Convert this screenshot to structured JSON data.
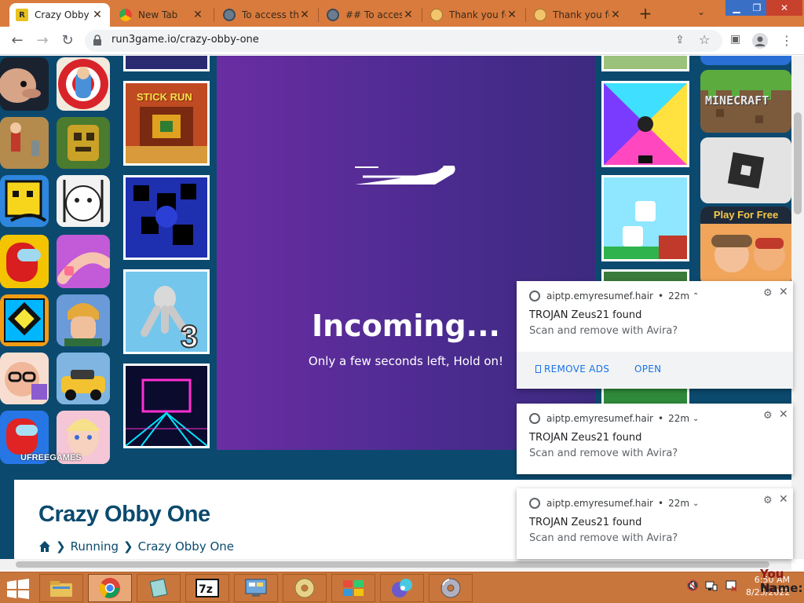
{
  "browser": {
    "tabs": [
      {
        "title": "Crazy Obby",
        "active": true,
        "favicon": "run3-icon"
      },
      {
        "title": "New Tab",
        "active": false,
        "favicon": "chrome-icon"
      },
      {
        "title": "To access th",
        "active": false,
        "favicon": "globe-icon"
      },
      {
        "title": "## To access",
        "active": false,
        "favicon": "globe-icon"
      },
      {
        "title": "Thank you fo",
        "active": false,
        "favicon": "smiley-icon"
      },
      {
        "title": "Thank you fo",
        "active": false,
        "favicon": "smiley-icon"
      }
    ],
    "url": "run3game.io/crazy-obby-one"
  },
  "page": {
    "title": "Crazy Obby One",
    "breadcrumb": [
      "Running",
      "Crazy Obby One"
    ],
    "game": {
      "loading_text": "Incoming...",
      "subtext": "Only a few seconds left, Hold on!"
    },
    "thumbs": {
      "left_labels": {
        "stick_run": "STICK RUN"
      },
      "ufree": "UFREEGAMES",
      "right_labels": {
        "minecraft": "MINECRAFT",
        "play_for_free": "Play For Free"
      }
    }
  },
  "notifications": [
    {
      "source": "aiptp.emyresumef.hair",
      "age": "22m",
      "title": "TROJAN Zeus21 found",
      "body": "Scan and remove with Avira?",
      "actions": [
        "REMOVE ADS",
        "OPEN"
      ],
      "expanded": true
    },
    {
      "source": "aiptp.emyresumef.hair",
      "age": "22m",
      "title": "TROJAN Zeus21 found",
      "body": "Scan and remove with Avira?",
      "expanded": false
    },
    {
      "source": "aiptp.emyresumef.hair",
      "age": "22m",
      "title": "TROJAN Zeus21 found",
      "body": "Scan and remove with Avira?",
      "expanded": false
    }
  ],
  "taskbar": {
    "time": "6:50 AM",
    "date": "8/25/2022",
    "peek_text_1": "You ha",
    "peek_text_2": "Name:"
  },
  "colors": {
    "tabstrip": "#d97b3d",
    "page_bg": "#0b4a6e",
    "game_purple": "#5a2c9c",
    "taskbar": "#c9763d",
    "link_blue": "#1a73e8"
  }
}
